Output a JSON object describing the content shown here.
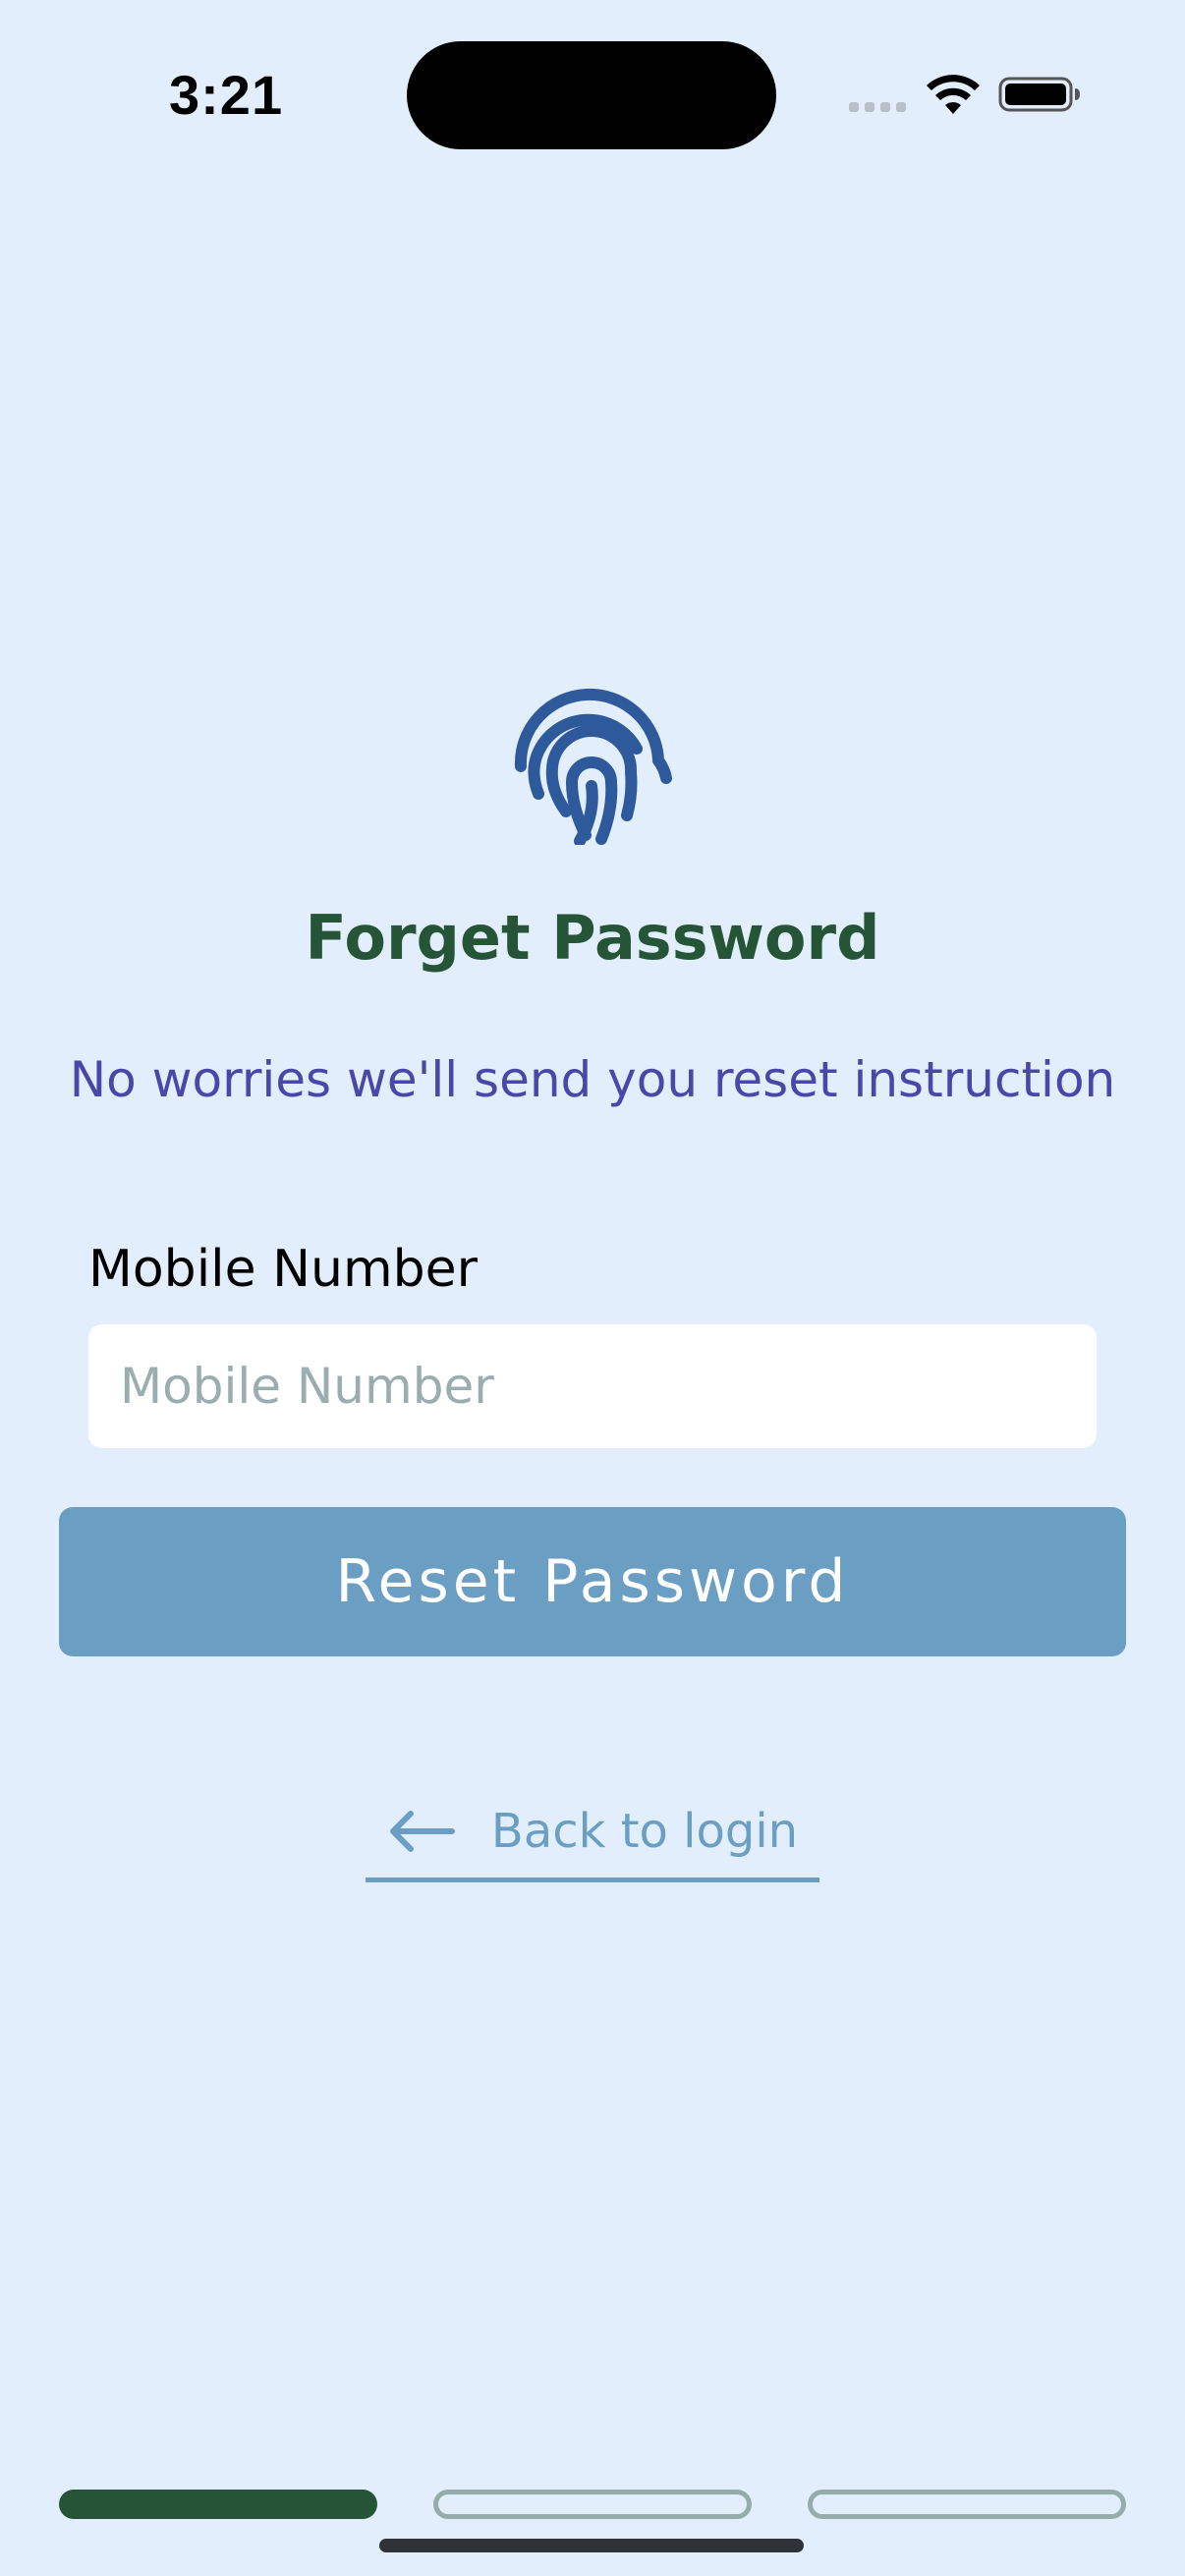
{
  "status_bar": {
    "time": "3:21",
    "signal_icon": "cellular-signal-icon",
    "wifi_icon": "wifi-icon",
    "battery_icon": "battery-icon"
  },
  "header": {
    "icon": "fingerprint-icon",
    "icon_color": "#2e5a9c",
    "title": "Forget Password",
    "title_color": "#255437",
    "subtitle": "No worries we'll send you reset instruction",
    "subtitle_color": "#4848a8"
  },
  "form": {
    "mobile_label": "Mobile Number",
    "mobile_placeholder": "Mobile Number",
    "mobile_value": "",
    "submit_label": "Reset Password",
    "submit_color": "#6a9ec3"
  },
  "back_link": {
    "icon": "arrow-left-icon",
    "label": "Back to login"
  },
  "pager": {
    "total": 3,
    "active_index": 0,
    "active_color": "#255437",
    "inactive_color": "#96acaa"
  },
  "colors": {
    "background": "#e2eefb"
  }
}
